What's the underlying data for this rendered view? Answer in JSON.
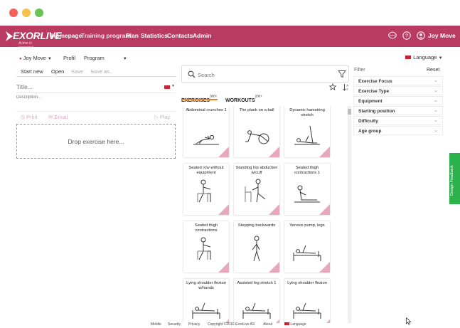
{
  "window": {
    "controls": {
      "close": "#f2625b",
      "minimize": "#f7c24b",
      "maximize": "#68c454"
    }
  },
  "navbar": {
    "brand": {
      "name": "EXORLIVE",
      "tagline": "Active in recovery!"
    },
    "items": [
      {
        "label": "Homepage",
        "active": false
      },
      {
        "label": "Training program",
        "active": true
      },
      {
        "label": "Plan",
        "active": false
      },
      {
        "label": "Statistics",
        "active": false
      },
      {
        "label": "Contacts",
        "active": false
      },
      {
        "label": "Admin",
        "active": false
      }
    ],
    "icons": [
      "chat-icon",
      "help-icon",
      "user-icon"
    ],
    "user": "Joy Move",
    "accent": "#b93b62"
  },
  "subbar": {
    "user": "Joy Move",
    "profile": "Profil",
    "program": "Program",
    "language": "Language"
  },
  "left": {
    "toolbar": {
      "start_new": "Start new",
      "open": "Open",
      "save": "Save",
      "save_as": "Save as.."
    },
    "title_placeholder": "Title...",
    "description_placeholder": "Description...",
    "actions": {
      "print": "Print",
      "email": "Email",
      "play": "Play"
    },
    "dropzone": "Drop exercise here..."
  },
  "middle": {
    "search_placeholder": "Search",
    "tabs": [
      {
        "label": "EXERCISES",
        "count": "300+",
        "active": true
      },
      {
        "label": "WORKOUTS",
        "count": "200+",
        "active": false
      }
    ],
    "exercises": [
      {
        "title": "Abdominal crunches 1",
        "figure": "crunch"
      },
      {
        "title": "The plank on a ball",
        "figure": "plank"
      },
      {
        "title": "Dynamic hamstring stretch",
        "figure": "stretch"
      },
      {
        "title": "Seated row without equipment",
        "figure": "seated"
      },
      {
        "title": "Standing hip abduction w/cuff",
        "figure": "standing-chair"
      },
      {
        "title": "Seated thigh contractions 1",
        "figure": "sit-floor"
      },
      {
        "title": "Seated thigh contractions",
        "figure": "seated"
      },
      {
        "title": "Stepping backwards",
        "figure": "stepping"
      },
      {
        "title": "Venous pump, legs",
        "figure": "bed"
      },
      {
        "title": "Lying shoulder flexion w/hands",
        "figure": "bed"
      },
      {
        "title": "Assisted leg stretch 1",
        "figure": "bed"
      },
      {
        "title": "Lying shoulder flexion",
        "figure": "bed"
      }
    ]
  },
  "right": {
    "filter_label": "Filter",
    "reset_label": "Reset",
    "filters": [
      "Exercise Focus",
      "Exercise Type",
      "Equipment",
      "Starting position",
      "Difficulty",
      "Age group"
    ]
  },
  "footer": {
    "items": [
      "Mobile",
      "Security",
      "Privacy",
      "Copyright ©2016 ExorLive AS",
      "About",
      "Language"
    ]
  },
  "feedback": {
    "label": "Design Feedback",
    "color": "#2bb24c"
  }
}
